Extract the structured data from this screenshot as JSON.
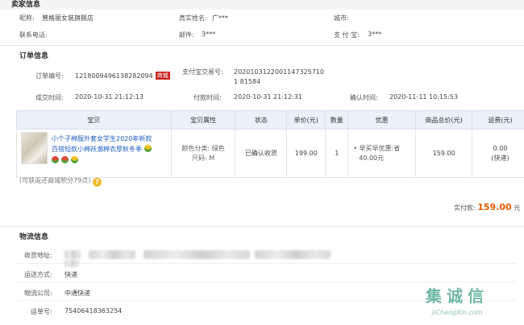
{
  "seller": {
    "section_title": "卖家信息",
    "nickname_label": "昵称:",
    "nickname_value": "曾格丽女装旗舰店",
    "realname_label": "真实姓名:",
    "realname_value": "广***",
    "city_label": "城市:",
    "contact_label": "联系电话:",
    "email_label": "邮件:",
    "email_value": "3***",
    "alipay_label": "支 付 宝:",
    "alipay_value": "3***"
  },
  "order": {
    "section_title": "订单信息",
    "number_label": "订单编号:",
    "number_value": "1218009496138282094",
    "number_badge": "商城",
    "alipay_trade_label": "支付宝交易号:",
    "alipay_trade_value": "20201031220011473257101 81584",
    "created_label": "成交时间:",
    "created_value": "2020-10-31 21:12:13",
    "paid_label": "付款时间:",
    "paid_value": "2020-10-31 21:12:31",
    "confirmed_label": "确认时间:",
    "confirmed_value": "2020-11-11 10:15:53"
  },
  "items_table": {
    "headers": [
      "宝贝",
      "宝贝属性",
      "状态",
      "单价(元)",
      "数量",
      "优惠",
      "商品总价(元)",
      "运费(元)"
    ],
    "row": {
      "title": "小个子棉服外套女学生2020年新款百搭短款小棉袄潮棉衣厚秋冬季",
      "attributes_line1": "颜色分类: 绿色",
      "attributes_line2": "尺码: M",
      "status": "已确认收货",
      "unit_price": "199.00",
      "quantity": "1",
      "discount_line1": "• 早买早优惠:省",
      "discount_line2": "40.00元",
      "subtotal": "159.00",
      "shipping_line1": "0.00",
      "shipping_line2": "(快递)"
    }
  },
  "credit_note": "(可获返还商城积分79点)",
  "total": {
    "label": "实付款:",
    "amount": "159.00",
    "unit": "元"
  },
  "logistics": {
    "section_title": "物流信息",
    "address_label": "收货地址:",
    "method_label": "运送方式:",
    "method_value": "快递",
    "company_label": "物流公司:",
    "company_value": "中通快递",
    "tracking_label": "运单号:",
    "tracking_value": "75406418363254"
  },
  "watermark": {
    "main": "集诚信",
    "sub": "JiChengXin.com"
  },
  "colors": {
    "link": "#1f5fbf",
    "accent_orange": "#e45a00",
    "badge_red": "#c8251e"
  }
}
